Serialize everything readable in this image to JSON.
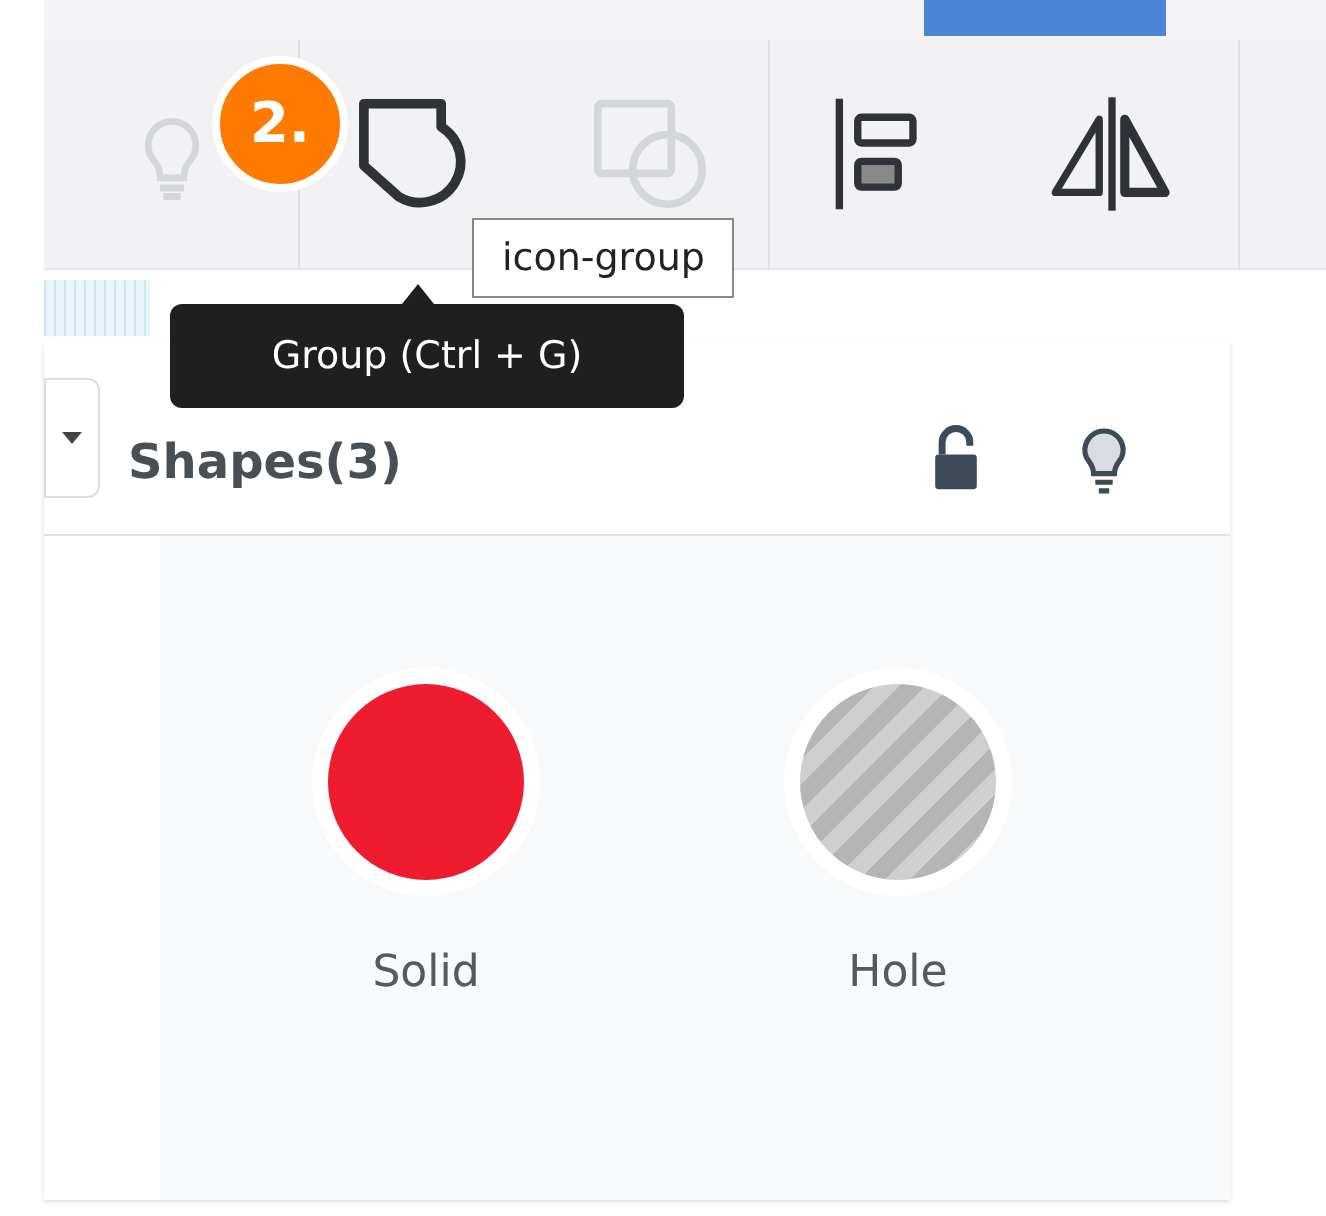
{
  "step_badge": "2.",
  "toolbar": [
    {
      "kind": "bulb",
      "disabled": true
    },
    {
      "kind": "group",
      "disabled": false
    },
    {
      "kind": "ungroup",
      "disabled": true
    },
    {
      "kind": "align",
      "disabled": false
    },
    {
      "kind": "mirror",
      "disabled": false
    }
  ],
  "tooltip": {
    "text": "Group (Ctrl + G)"
  },
  "element_label": "icon-group",
  "panel": {
    "title": "Shapes(3)",
    "locked": false,
    "shapes": [
      {
        "kind": "solid",
        "label": "Solid"
      },
      {
        "kind": "hole",
        "label": "Hole"
      }
    ]
  }
}
